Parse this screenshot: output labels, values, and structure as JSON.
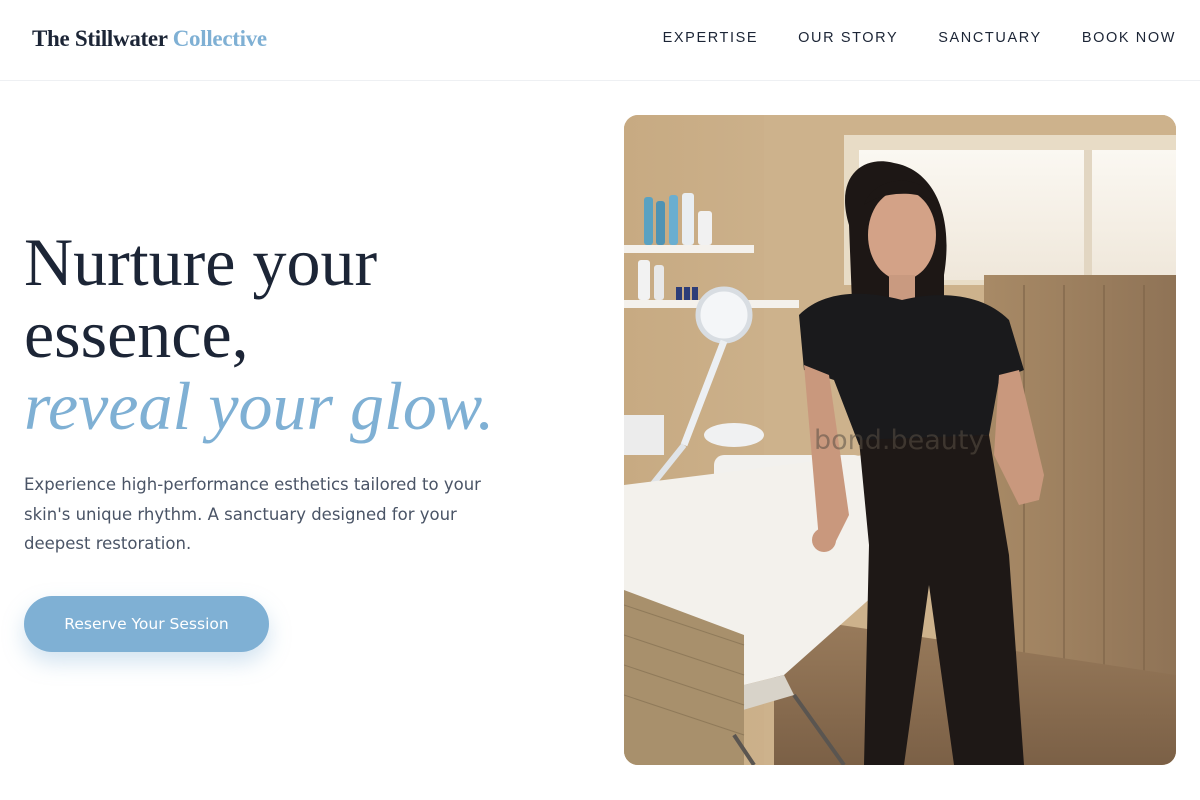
{
  "header": {
    "brand": {
      "main": "The Stillwater ",
      "accent": "Collective"
    },
    "nav": [
      {
        "label": "EXPERTISE"
      },
      {
        "label": "OUR STORY"
      },
      {
        "label": "SANCTUARY"
      },
      {
        "label": "BOOK NOW"
      }
    ]
  },
  "hero": {
    "headline": {
      "line1": "Nurture your",
      "line2": "essence,",
      "accent": "reveal your glow."
    },
    "description": "Experience high-performance esthetics tailored to your skin's unique rhythm. A sanctuary designed for your deepest restoration.",
    "cta_label": "Reserve Your Session",
    "image_watermark": "bond.beauty"
  },
  "colors": {
    "accent": "#7fb0d4",
    "heading": "#1c2536",
    "body_text": "#4a5466",
    "background": "#ffffff"
  }
}
